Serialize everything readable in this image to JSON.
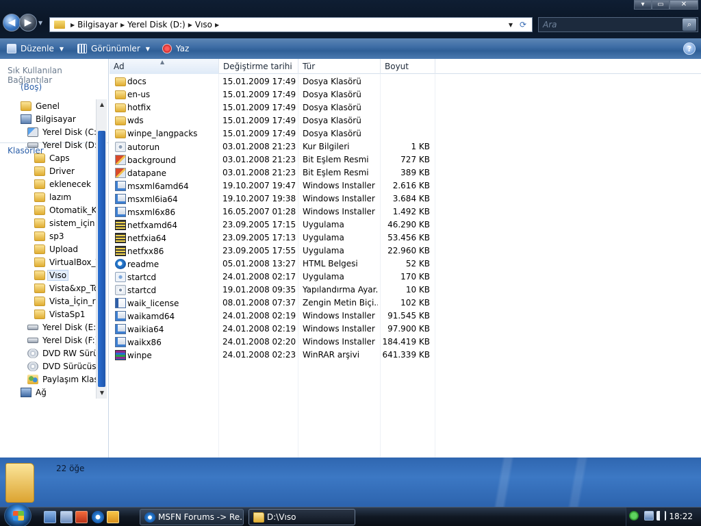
{
  "window": {
    "controls": {
      "minimize": "▾",
      "maximize": "▭",
      "close": "✕"
    }
  },
  "address": {
    "crumbs": [
      "Bilgisayar",
      "Yerel Disk (D:)",
      "Vıso"
    ]
  },
  "search": {
    "placeholder": "Ara"
  },
  "toolbar": {
    "organize": "Düzenle",
    "views": "Görünümler",
    "print": "Yaz"
  },
  "leftpane": {
    "favorites_title": "Sık Kullanılan Bağlantılar",
    "favorites_empty": "(Boş)",
    "folders_title": "Klasörler",
    "tree": [
      {
        "label": "Genel",
        "icon": "folder-icon",
        "depth": 1
      },
      {
        "label": "Bilgisayar",
        "icon": "computer-icon",
        "depth": 1
      },
      {
        "label": "Yerel Disk (C:)",
        "icon": "system-drive-icon",
        "depth": 2
      },
      {
        "label": "Yerel Disk (D:)",
        "icon": "drive-icon",
        "depth": 2
      },
      {
        "label": "Caps",
        "icon": "folder-icon",
        "depth": 3
      },
      {
        "label": "Driver",
        "icon": "folder-icon",
        "depth": 3
      },
      {
        "label": "eklenecek",
        "icon": "folder-icon",
        "depth": 3
      },
      {
        "label": "lazım",
        "icon": "folder-icon",
        "depth": 3
      },
      {
        "label": "Otomatik_Ku",
        "icon": "folder-icon",
        "depth": 3
      },
      {
        "label": "sistem_için",
        "icon": "folder-icon",
        "depth": 3
      },
      {
        "label": "sp3",
        "icon": "folder-icon",
        "depth": 3
      },
      {
        "label": "Upload",
        "icon": "folder-icon",
        "depth": 3
      },
      {
        "label": "VirtualBox_VI",
        "icon": "folder-icon",
        "depth": 3
      },
      {
        "label": "Vıso",
        "icon": "folder-icon",
        "depth": 3,
        "selected": true
      },
      {
        "label": "Vista&xp_To",
        "icon": "folder-icon",
        "depth": 3
      },
      {
        "label": "Vista_İçin_res",
        "icon": "folder-icon",
        "depth": 3
      },
      {
        "label": "VistaSp1",
        "icon": "folder-icon",
        "depth": 3
      },
      {
        "label": "Yerel Disk (E:)",
        "icon": "drive-icon",
        "depth": 2
      },
      {
        "label": "Yerel Disk (F:)",
        "icon": "drive-icon",
        "depth": 2
      },
      {
        "label": "DVD RW Sürüc",
        "icon": "dvd-icon",
        "depth": 2
      },
      {
        "label": "DVD Sürücüsü",
        "icon": "dvd-icon",
        "depth": 2
      },
      {
        "label": "Paylaşım Klasö",
        "icon": "shared-folder-icon",
        "depth": 2
      },
      {
        "label": "Ağ",
        "icon": "network-icon",
        "depth": 1
      }
    ]
  },
  "columns": {
    "name": "Ad",
    "date": "Değiştirme tarihi",
    "type": "Tür",
    "size": "Boyut"
  },
  "files": [
    {
      "name": "docs",
      "date": "15.01.2009 17:49",
      "type": "Dosya Klasörü",
      "size": "",
      "icon": "folder"
    },
    {
      "name": "en-us",
      "date": "15.01.2009 17:49",
      "type": "Dosya Klasörü",
      "size": "",
      "icon": "folder"
    },
    {
      "name": "hotfix",
      "date": "15.01.2009 17:49",
      "type": "Dosya Klasörü",
      "size": "",
      "icon": "folder"
    },
    {
      "name": "wds",
      "date": "15.01.2009 17:49",
      "type": "Dosya Klasörü",
      "size": "",
      "icon": "folder"
    },
    {
      "name": "winpe_langpacks",
      "date": "15.01.2009 17:49",
      "type": "Dosya Klasörü",
      "size": "",
      "icon": "folder"
    },
    {
      "name": "autorun",
      "date": "03.01.2008 21:23",
      "type": "Kur Bilgileri",
      "size": "1 KB",
      "icon": "settings"
    },
    {
      "name": "background",
      "date": "03.01.2008 21:23",
      "type": "Bit Eşlem Resmi",
      "size": "727 KB",
      "icon": "bitmap"
    },
    {
      "name": "datapane",
      "date": "03.01.2008 21:23",
      "type": "Bit Eşlem Resmi",
      "size": "389 KB",
      "icon": "bitmap"
    },
    {
      "name": "msxml6amd64",
      "date": "19.10.2007 19:47",
      "type": "Windows Installer ...",
      "size": "2.616 KB",
      "icon": "msi"
    },
    {
      "name": "msxml6ia64",
      "date": "19.10.2007 19:38",
      "type": "Windows Installer ...",
      "size": "3.684 KB",
      "icon": "msi"
    },
    {
      "name": "msxml6x86",
      "date": "16.05.2007 01:28",
      "type": "Windows Installer ...",
      "size": "1.492 KB",
      "icon": "msi"
    },
    {
      "name": "netfxamd64",
      "date": "23.09.2005 17:15",
      "type": "Uygulama",
      "size": "46.290 KB",
      "icon": "exe"
    },
    {
      "name": "netfxia64",
      "date": "23.09.2005 17:13",
      "type": "Uygulama",
      "size": "53.456 KB",
      "icon": "exe"
    },
    {
      "name": "netfxx86",
      "date": "23.09.2005 17:55",
      "type": "Uygulama",
      "size": "22.960 KB",
      "icon": "exe"
    },
    {
      "name": "readme",
      "date": "05.01.2008 13:27",
      "type": "HTML Belgesi",
      "size": "52 KB",
      "icon": "ie"
    },
    {
      "name": "startcd",
      "date": "24.01.2008 02:17",
      "type": "Uygulama",
      "size": "170 KB",
      "icon": "app"
    },
    {
      "name": "startcd",
      "date": "19.01.2008 09:35",
      "type": "Yapılandırma Ayar...",
      "size": "10 KB",
      "icon": "cfg"
    },
    {
      "name": "waik_license",
      "date": "08.01.2008 07:37",
      "type": "Zengin Metin Biçi...",
      "size": "102 KB",
      "icon": "rtf"
    },
    {
      "name": "waikamd64",
      "date": "24.01.2008 02:19",
      "type": "Windows Installer ...",
      "size": "91.545 KB",
      "icon": "msi"
    },
    {
      "name": "waikia64",
      "date": "24.01.2008 02:19",
      "type": "Windows Installer ...",
      "size": "97.900 KB",
      "icon": "msi"
    },
    {
      "name": "waikx86",
      "date": "24.01.2008 02:20",
      "type": "Windows Installer ...",
      "size": "184.419 KB",
      "icon": "msi"
    },
    {
      "name": "winpe",
      "date": "24.01.2008 02:23",
      "type": "WinRAR arşivi",
      "size": "641.339 KB",
      "icon": "rar"
    }
  ],
  "details": {
    "count": "22 öğe"
  },
  "taskbar": {
    "buttons": [
      {
        "label": "MSFN Forums -> Re...",
        "icon": "ie"
      },
      {
        "label": "D:\\Vıso",
        "icon": "folder"
      }
    ],
    "clock": "18:22"
  },
  "colors": {
    "accent": "#2a5ea8",
    "toolbar": "#3f6ea6",
    "details": "#2f66b0",
    "selection": "#e4eefb"
  }
}
